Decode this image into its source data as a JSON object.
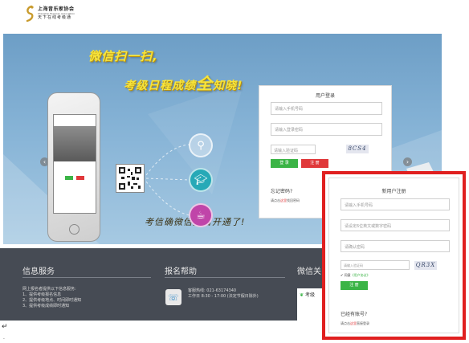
{
  "header": {
    "logo_cn": "上海音乐家协会",
    "logo_en": "Shanghai Musician Association",
    "logo_sub": "天下在线考级通"
  },
  "banner": {
    "slogan_1": "微信扫一扫,",
    "slogan_2_prefix": "考级日程成绩",
    "slogan_2_highlight": "全",
    "slogan_2_suffix": "知晓!",
    "slogan_3": "考信确微信报名开通了!",
    "prev_icon": "chevron-left-icon",
    "next_icon": "chevron-right-icon"
  },
  "login": {
    "title": "用户登录",
    "phone_placeholder": "请输入手机号码",
    "password_placeholder": "请输入登录密码",
    "captcha_placeholder": "请输入验证码",
    "captcha_text": "8CS4",
    "login_button": "登 录",
    "register_button": "注 册",
    "forgot_title": "忘记密码?",
    "forgot_hint_prefix": "请点击",
    "forgot_hint_link": "这里",
    "forgot_hint_suffix": "找回密码"
  },
  "register": {
    "title": "新用户注册",
    "phone_placeholder": "请输入手机号码",
    "password_placeholder": "请设定6位英文或数字密码",
    "confirm_placeholder": "请确认密码",
    "captcha_placeholder": "请输入验证码",
    "captcha_text": "QR3X",
    "agree_label": "同意",
    "agree_link": "《用户协议》",
    "register_button": "注 册",
    "have_account": "已经有账号?",
    "have_hint_prefix": "请点击",
    "have_hint_link": "这里",
    "have_hint_suffix": "直接登录"
  },
  "footer": {
    "info_title": "信息服务",
    "info_lines": [
      "网上报名者提供以下信息服务:",
      "1、提供考级报名信息",
      "2、提供考级地点、时间即时通知",
      "3、提供考级成绩即时通知"
    ],
    "help_title": "报名帮助",
    "help_phone": "客服热线: 021-63174340",
    "help_hours": "工作日 8:30 - 17:00 (法定节假日除外)",
    "wechat_title": "微信关",
    "wechat_label": "考级"
  },
  "colors": {
    "accent_green": "#3bb446",
    "accent_red": "#e0383a",
    "footer_bg": "#464b54",
    "highlight_frame": "#e02020"
  }
}
